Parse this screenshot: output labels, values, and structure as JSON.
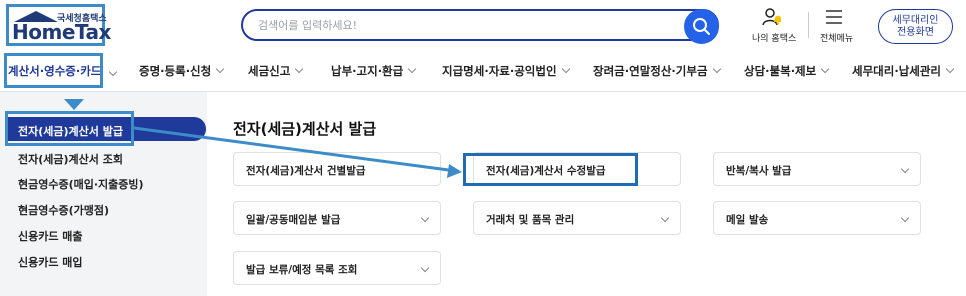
{
  "header": {
    "logo_small": "국세청홈택스",
    "logo_text": "HomeTax",
    "search_placeholder": "검색어를 입력하세요!",
    "my_home_label": "나의 홈택스",
    "full_menu_label": "전체메뉴",
    "agent_button_line1": "세무대리인",
    "agent_button_line2": "전용화면"
  },
  "nav": {
    "items": [
      {
        "label": "계산서·영수증·카드"
      },
      {
        "label": "증명·등록·신청"
      },
      {
        "label": "세금신고"
      },
      {
        "label": "납부·고지·환급"
      },
      {
        "label": "지급명세·자료·공익법인"
      },
      {
        "label": "장려금·연말정산·기부금"
      },
      {
        "label": "상담·불복·제보"
      },
      {
        "label": "세무대리·납세관리"
      }
    ]
  },
  "sidebar": {
    "items": [
      {
        "label": "전자(세금)계산서 발급"
      },
      {
        "label": "전자(세금)계산서 조회"
      },
      {
        "label": "현금영수증(매입·지출증빙)"
      },
      {
        "label": "현금영수증(가맹점)"
      },
      {
        "label": "신용카드 매출"
      },
      {
        "label": "신용카드 매입"
      }
    ]
  },
  "main": {
    "title": "전자(세금)계산서 발급",
    "cards": [
      {
        "label": "전자(세금)계산서 건별발급"
      },
      {
        "label": "전자(세금)계산서 수정발급"
      },
      {
        "label": "반복/복사 발급"
      },
      {
        "label": "일괄/공동매입분 발급"
      },
      {
        "label": "거래처 및 품목 관리"
      },
      {
        "label": "메일 발송"
      },
      {
        "label": "발급 보류/예정 목록 조회"
      }
    ]
  },
  "colors": {
    "brand_navy": "#1f3a9a",
    "search_button": "#2462e8",
    "highlight": "#3d8cc9"
  },
  "icons": [
    "search-icon",
    "person-bell-icon",
    "hamburger-icon",
    "chevron-down-icon",
    "arrow-icon"
  ]
}
